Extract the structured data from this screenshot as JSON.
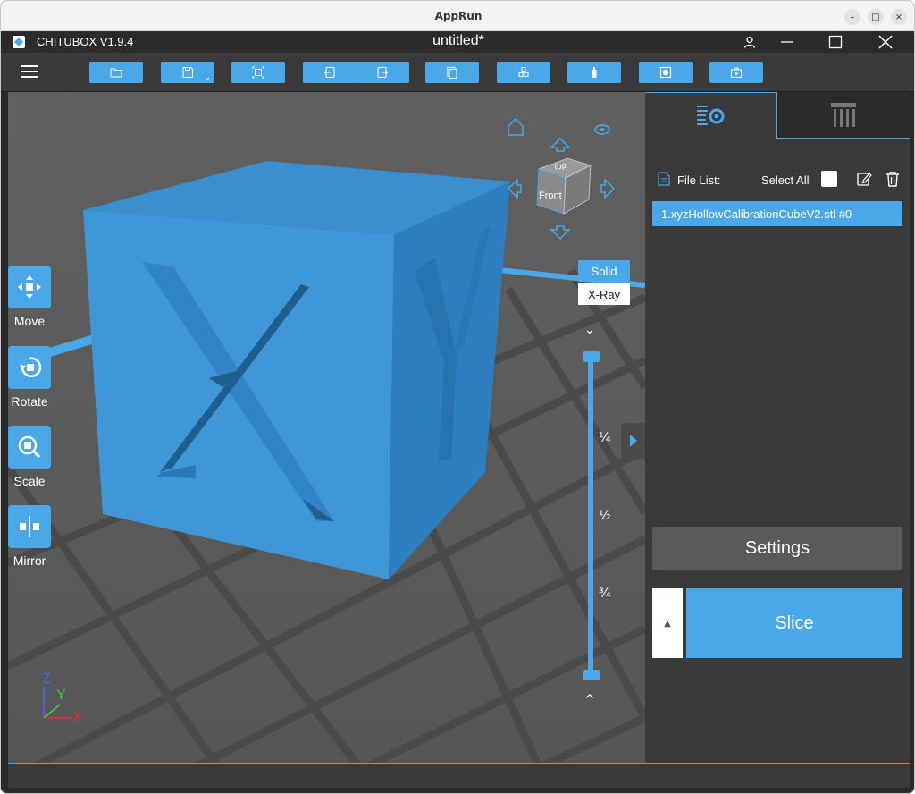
{
  "os_window": {
    "title": "AppRun"
  },
  "app": {
    "name": "CHITUBOX V1.9.4",
    "document_title": "untitled*",
    "accent_color": "#4aa8e8"
  },
  "toolbar": {
    "menu_icon": "hamburger-icon",
    "buttons": [
      {
        "icon": "open-folder-icon"
      },
      {
        "icon": "save-icon",
        "has_dropdown": true
      },
      {
        "icon": "auto-layout-icon"
      },
      {
        "icon": "undo-icon"
      },
      {
        "icon": "redo-icon"
      },
      {
        "icon": "copy-icon"
      },
      {
        "icon": "multiply-icon"
      },
      {
        "icon": "hollow-icon"
      },
      {
        "icon": "dig-hole-icon"
      },
      {
        "icon": "repair-icon"
      }
    ]
  },
  "left_tools": [
    {
      "label": "Move",
      "icon": "move-icon"
    },
    {
      "label": "Rotate",
      "icon": "rotate-icon"
    },
    {
      "label": "Scale",
      "icon": "scale-icon"
    },
    {
      "label": "Mirror",
      "icon": "mirror-icon"
    }
  ],
  "view_cube": {
    "front": "Front",
    "top": "Top"
  },
  "view_modes": {
    "solid": "Solid",
    "xray": "X-Ray",
    "active": "Solid"
  },
  "slider": {
    "ticks": [
      "¼",
      "½",
      "¾"
    ],
    "up": "^",
    "down": "⌄"
  },
  "axes": {
    "x": "X",
    "y": "Y",
    "z": "Z"
  },
  "right_panel": {
    "tabs": [
      {
        "icon": "settings-list-icon",
        "active": true
      },
      {
        "icon": "supports-icon",
        "active": false
      }
    ],
    "file_list_label": "File List:",
    "select_all_label": "Select All",
    "files": [
      "1.xyzHollowCalibrationCubeV2.stl #0"
    ],
    "settings_label": "Settings",
    "slice_label": "Slice"
  }
}
